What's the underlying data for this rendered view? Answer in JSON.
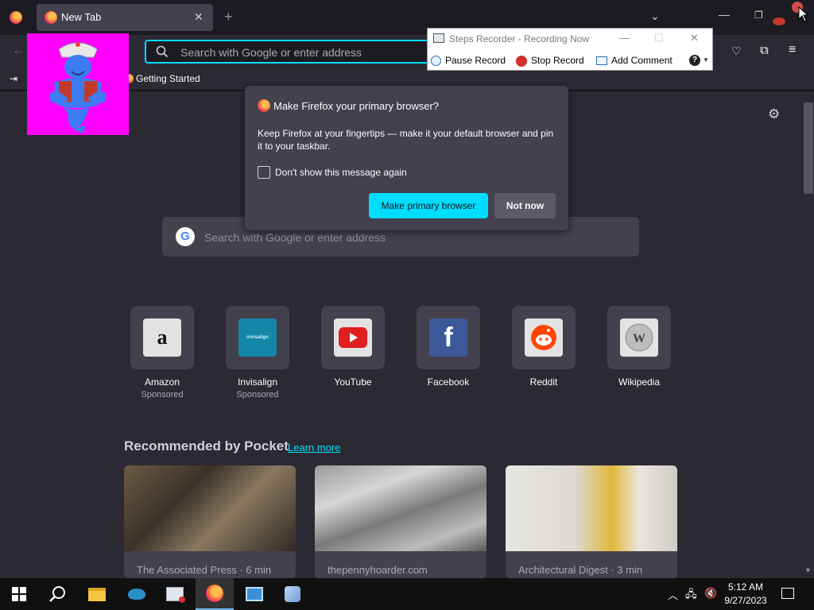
{
  "browser": {
    "tab": {
      "title": "New Tab"
    },
    "new_tab_symbol": "+",
    "url_placeholder": "Search with Google or enter address",
    "bookmarks": [
      {
        "label": "Getting Started"
      }
    ]
  },
  "newtab": {
    "search_placeholder": "Search with Google or enter address",
    "top_sites": [
      {
        "label": "Amazon",
        "sponsored": "Sponsored",
        "icon": "amazon-icon",
        "color": "#e3e3e3"
      },
      {
        "label": "Invisalign",
        "sponsored": "Sponsored",
        "icon": "invisalign-icon",
        "color": "#1487a8"
      },
      {
        "label": "YouTube",
        "sponsored": "",
        "icon": "youtube-icon",
        "color": "#e3e3e3"
      },
      {
        "label": "Facebook",
        "sponsored": "",
        "icon": "facebook-icon",
        "color": "#3b5998"
      },
      {
        "label": "Reddit",
        "sponsored": "",
        "icon": "reddit-icon",
        "color": "#e3e3e3"
      },
      {
        "label": "Wikipedia",
        "sponsored": "",
        "icon": "wikipedia-icon",
        "color": "#e3e3e3"
      }
    ],
    "pocket": {
      "title": "Recommended by Pocket",
      "learn_more": "Learn more",
      "cards": [
        {
          "source": "The Associated Press · 6 min"
        },
        {
          "source": "thepennyhoarder.com"
        },
        {
          "source": "Architectural Digest · 3 min"
        }
      ]
    }
  },
  "dialog": {
    "title": "Make Firefox your primary browser?",
    "body": "Keep Firefox at your fingertips — make it your default browser and pin it to your taskbar.",
    "checkbox_label": "Don't show this message again",
    "checkbox_checked": false,
    "primary_button": "Make primary browser",
    "secondary_button": "Not now"
  },
  "steps_recorder": {
    "title": "Steps Recorder - Recording Now",
    "pause": "Pause Record",
    "stop": "Stop Record",
    "comment": "Add Comment"
  },
  "taskbar": {
    "time": "5:12 AM",
    "date": "9/27/2023"
  },
  "colors": {
    "accent": "#00ddff",
    "background": "#2b2a33",
    "dialog": "#42414d"
  }
}
